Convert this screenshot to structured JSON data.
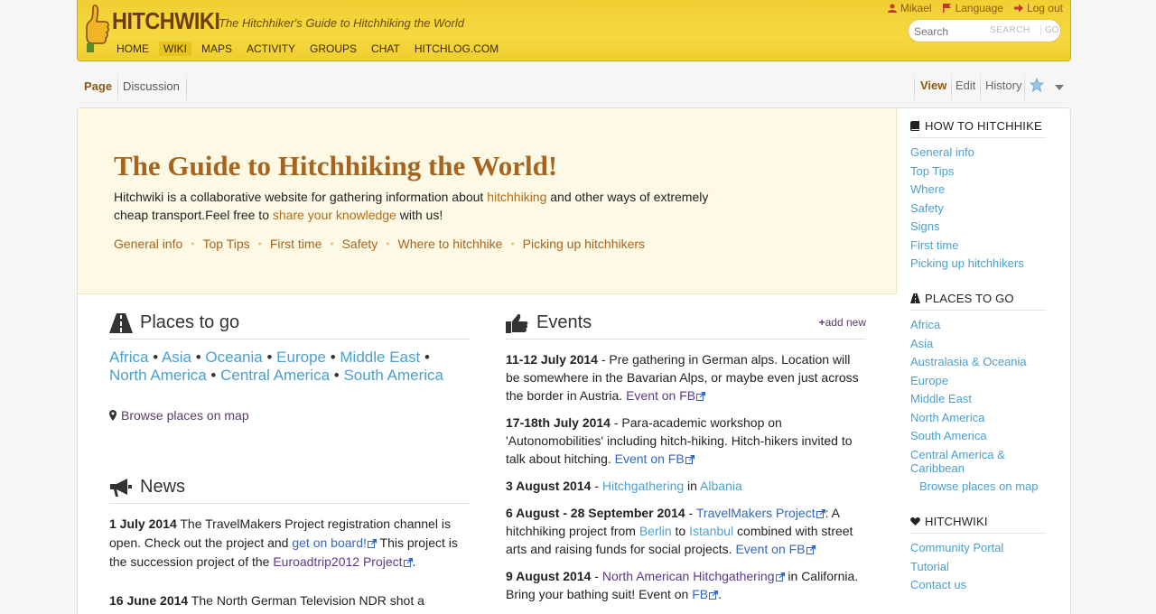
{
  "header": {
    "logo_text": "HITCHWIKI",
    "tagline": "The Hitchhiker's Guide to Hitchhiking the World",
    "nav": [
      "HOME",
      "WIKI",
      "MAPS",
      "ACTIVITY",
      "GROUPS",
      "CHAT",
      "HITCHLOG.COM"
    ],
    "user": "Mikael",
    "language": "Language",
    "logout": "Log out",
    "search_placeholder": "Search",
    "search_btn": "SEARCH",
    "go_btn": "GO"
  },
  "tabs": {
    "page": "Page",
    "discussion": "Discussion",
    "view": "View",
    "edit": "Edit",
    "history": "History"
  },
  "hero": {
    "title": "The Guide to Hitchhiking the World!",
    "desc_1": "Hitchwiki is a collaborative website for gathering information about ",
    "desc_link1": "hitchhiking",
    "desc_2": " and other ways of extremely cheap transport.Feel free to ",
    "desc_link2": "share your knowledge",
    "desc_3": " with us!",
    "links": [
      "General info",
      "Top Tips",
      "First time",
      "Safety",
      "Where to hitchhike",
      "Picking up hitchhikers"
    ]
  },
  "places": {
    "title": "Places to go",
    "continents": [
      "Africa",
      "Asia",
      "Oceania",
      "Europe",
      "Middle East",
      "North America",
      "Central America",
      "South America"
    ],
    "map_link": "Browse places on map"
  },
  "news": {
    "title": "News",
    "items": [
      {
        "date": "1 July 2014",
        "t1": " The TravelMakers Project registration channel is open. Check out the project and ",
        "l1": "get on board!",
        "t2": " This project is the succession project of the ",
        "l2": "Euroadtrip2012 Project",
        "t3": "."
      },
      {
        "date": "16 June 2014",
        "t1": " The North German Television NDR shot a"
      }
    ]
  },
  "events": {
    "title": "Events",
    "add_new": "add new",
    "items": [
      {
        "date": "11-12 July 2014",
        "text": " - Pre gathering in German alps. Location will be somewhere in the Bavarian Alps, or maybe even just across the border in Austria. ",
        "link": "Event on FB"
      },
      {
        "date": "17-18th July 2014",
        "text": " - Para-academic workshop on 'Autonomobilities' including hitch-hiking. Hitch-hikers invited to talk about hitching. ",
        "link": "Event on FB"
      },
      {
        "date": "3 August 2014",
        "dash": " - ",
        "l1": "Hitchgathering",
        "mid": " in ",
        "l2": "Albania"
      },
      {
        "date": "6 August - 28 September 2014",
        "dash": " - ",
        "l1": "TravelMakers Project",
        "t1": ": A hitchhiking project from ",
        "l2": "Berlin",
        "t2": " to ",
        "l3": "Istanbul",
        "t3": " combined with street arts and raising funds for social projects. ",
        "l4": "Event on FB"
      },
      {
        "date": "9 August 2014",
        "dash": " - ",
        "l1": "North American Hitchgathering",
        "t1": " in California. Bring your bathing suit! Event on ",
        "l2": "FB",
        "t2": "."
      }
    ]
  },
  "sidebar": {
    "howto_title": "HOW TO HITCHHIKE",
    "howto": [
      "General info",
      "Top Tips",
      "Where",
      "Safety",
      "Signs",
      "First time",
      "Picking up hitchhikers"
    ],
    "places_title": "PLACES TO GO",
    "places": [
      "Africa",
      "Asia",
      "Australasia & Oceania",
      "Europe",
      "Middle East",
      "North America",
      "South America",
      "Central America & Caribbean"
    ],
    "places_map": "Browse places on map",
    "hitchwiki_title": "HITCHWIKI",
    "hitchwiki": [
      "Community Portal",
      "Tutorial",
      "Contact us"
    ]
  }
}
